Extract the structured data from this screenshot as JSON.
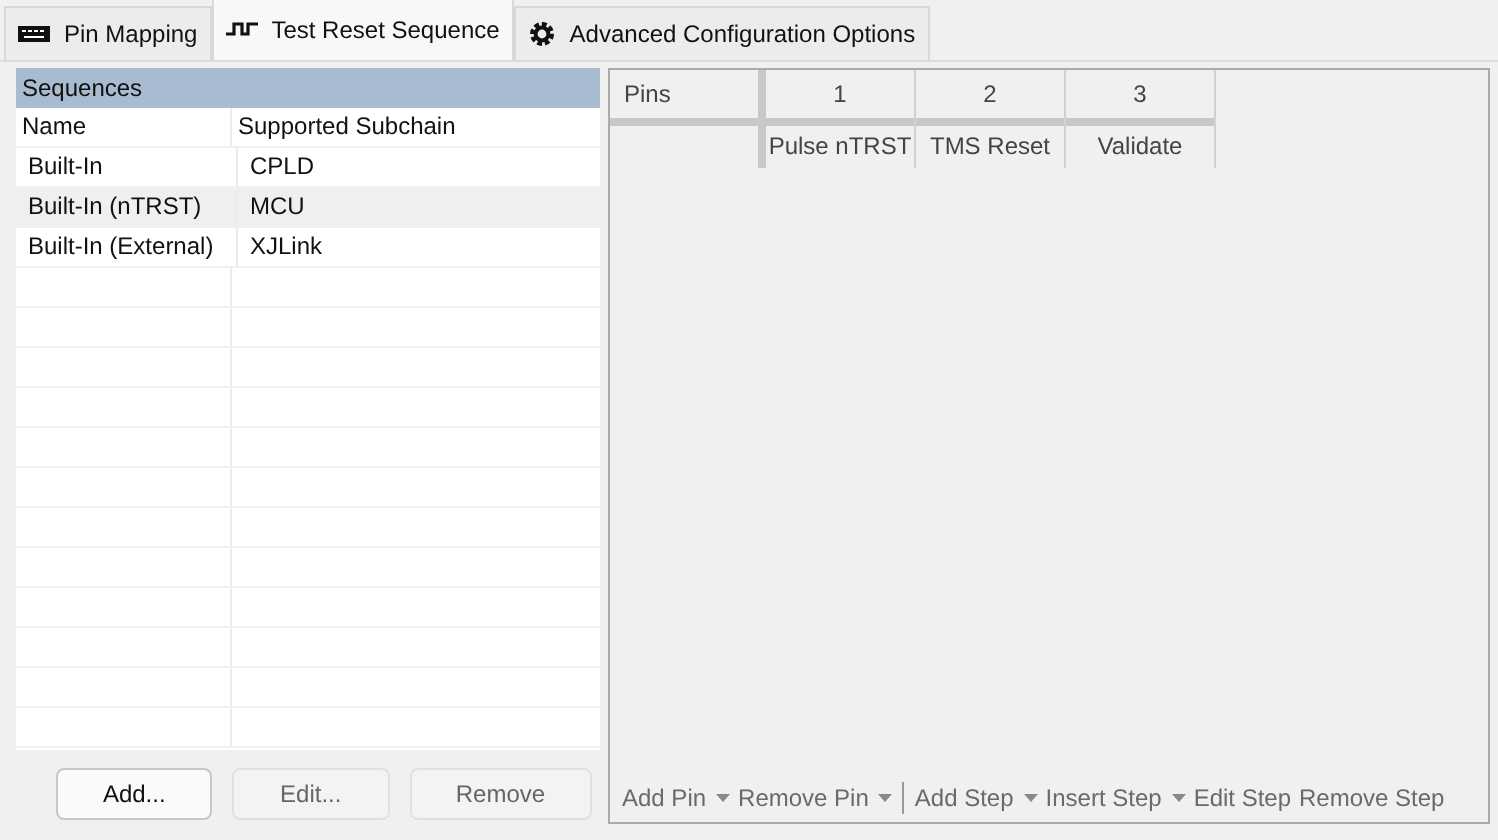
{
  "tabs": [
    {
      "label": "Pin Mapping",
      "selected": false
    },
    {
      "label": "Test Reset Sequence",
      "selected": true
    },
    {
      "label": "Advanced Configuration Options",
      "selected": false
    }
  ],
  "sequences": {
    "title": "Sequences",
    "columns": [
      "Name",
      "Supported Subchain"
    ],
    "rows": [
      {
        "name": "Built-In",
        "subchain": "CPLD",
        "selected": false
      },
      {
        "name": "Built-In (nTRST)",
        "subchain": "MCU",
        "selected": true
      },
      {
        "name": "Built-In (External)",
        "subchain": "XJLink",
        "selected": false
      }
    ],
    "buttons": [
      {
        "label": "Add...",
        "disabled": false
      },
      {
        "label": "Edit...",
        "disabled": true
      },
      {
        "label": "Remove",
        "disabled": true
      }
    ]
  },
  "steps": {
    "corner": "Pins",
    "columns": [
      {
        "number": "1",
        "name": "Pulse nTRST"
      },
      {
        "number": "2",
        "name": "TMS Reset"
      },
      {
        "number": "3",
        "name": "Validate"
      }
    ],
    "toolbar": [
      {
        "label": "Add Pin",
        "kind": "dropdown",
        "disabled": true
      },
      {
        "label": "Remove Pin",
        "kind": "dropdown",
        "disabled": true
      },
      {
        "label": "Add Step",
        "kind": "dropdown",
        "disabled": true
      },
      {
        "label": "Insert Step",
        "kind": "dropdown",
        "disabled": true
      },
      {
        "label": "Edit Step",
        "kind": "button",
        "disabled": true
      },
      {
        "label": "Remove Step",
        "kind": "button",
        "disabled": true
      }
    ]
  }
}
